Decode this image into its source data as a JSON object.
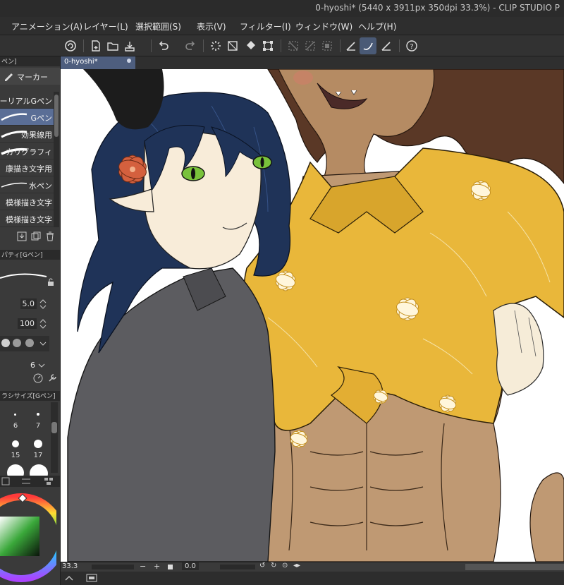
{
  "window": {
    "title": "0-hyoshi* (5440 x 3911px 350dpi 33.3%)  - CLIP STUDIO P"
  },
  "menu": [
    "アニメーション(A)",
    "レイヤー(L)",
    "選択範囲(S)",
    "表示(V)",
    "フィルター(I)",
    "ウィンドウ(W)",
    "ヘルプ(H)"
  ],
  "toolbar": {
    "icons": [
      "clip-studio-logo-icon",
      "new-file-icon",
      "open-folder-icon",
      "save-icon",
      "undo-icon",
      "redo-icon",
      "loading-icon",
      "fill-icon",
      "transform-icon",
      "deselect-icon",
      "invert-selection-icon",
      "show-selection-icon",
      "pen-stabilize-icon",
      "pen-tool-icon",
      "ruler-icon",
      "help-icon"
    ]
  },
  "left_panel": {
    "top_tab": "ペン]",
    "sub_tool": "マーカー",
    "brushes": [
      {
        "name": "ーリアルGペン",
        "selected": false
      },
      {
        "name": "Gペン",
        "selected": true
      },
      {
        "name": "効果線用",
        "selected": false
      },
      {
        "name": "カリグラフィ",
        "selected": false
      },
      {
        "name": "康描き文字用",
        "selected": false
      },
      {
        "name": "水ペン",
        "selected": false
      },
      {
        "name": "模様描き文字",
        "selected": false
      },
      {
        "name": "模様描き文字",
        "selected": false
      }
    ],
    "property_tab": "パティ[Gペン]",
    "brush_size": "5.0",
    "opacity": "100",
    "stabilization": "6",
    "size_tab": "ラシサイズ[Gペン]",
    "sizes": [
      "6",
      "7",
      "15",
      "17"
    ]
  },
  "document": {
    "tab_name": "0-hyoshi*"
  },
  "status": {
    "zoom": "33.3",
    "rotation": "0.0"
  },
  "colors": {
    "accent": "#5a6e96",
    "canvas_bg": "#ffffff",
    "shirt": "#e9b73a",
    "hair_dark": "#1f3358",
    "skin_tan": "#c19a73",
    "flower": "#d4603e",
    "eyes": "#79c23b",
    "coat": "#5c5c60"
  }
}
